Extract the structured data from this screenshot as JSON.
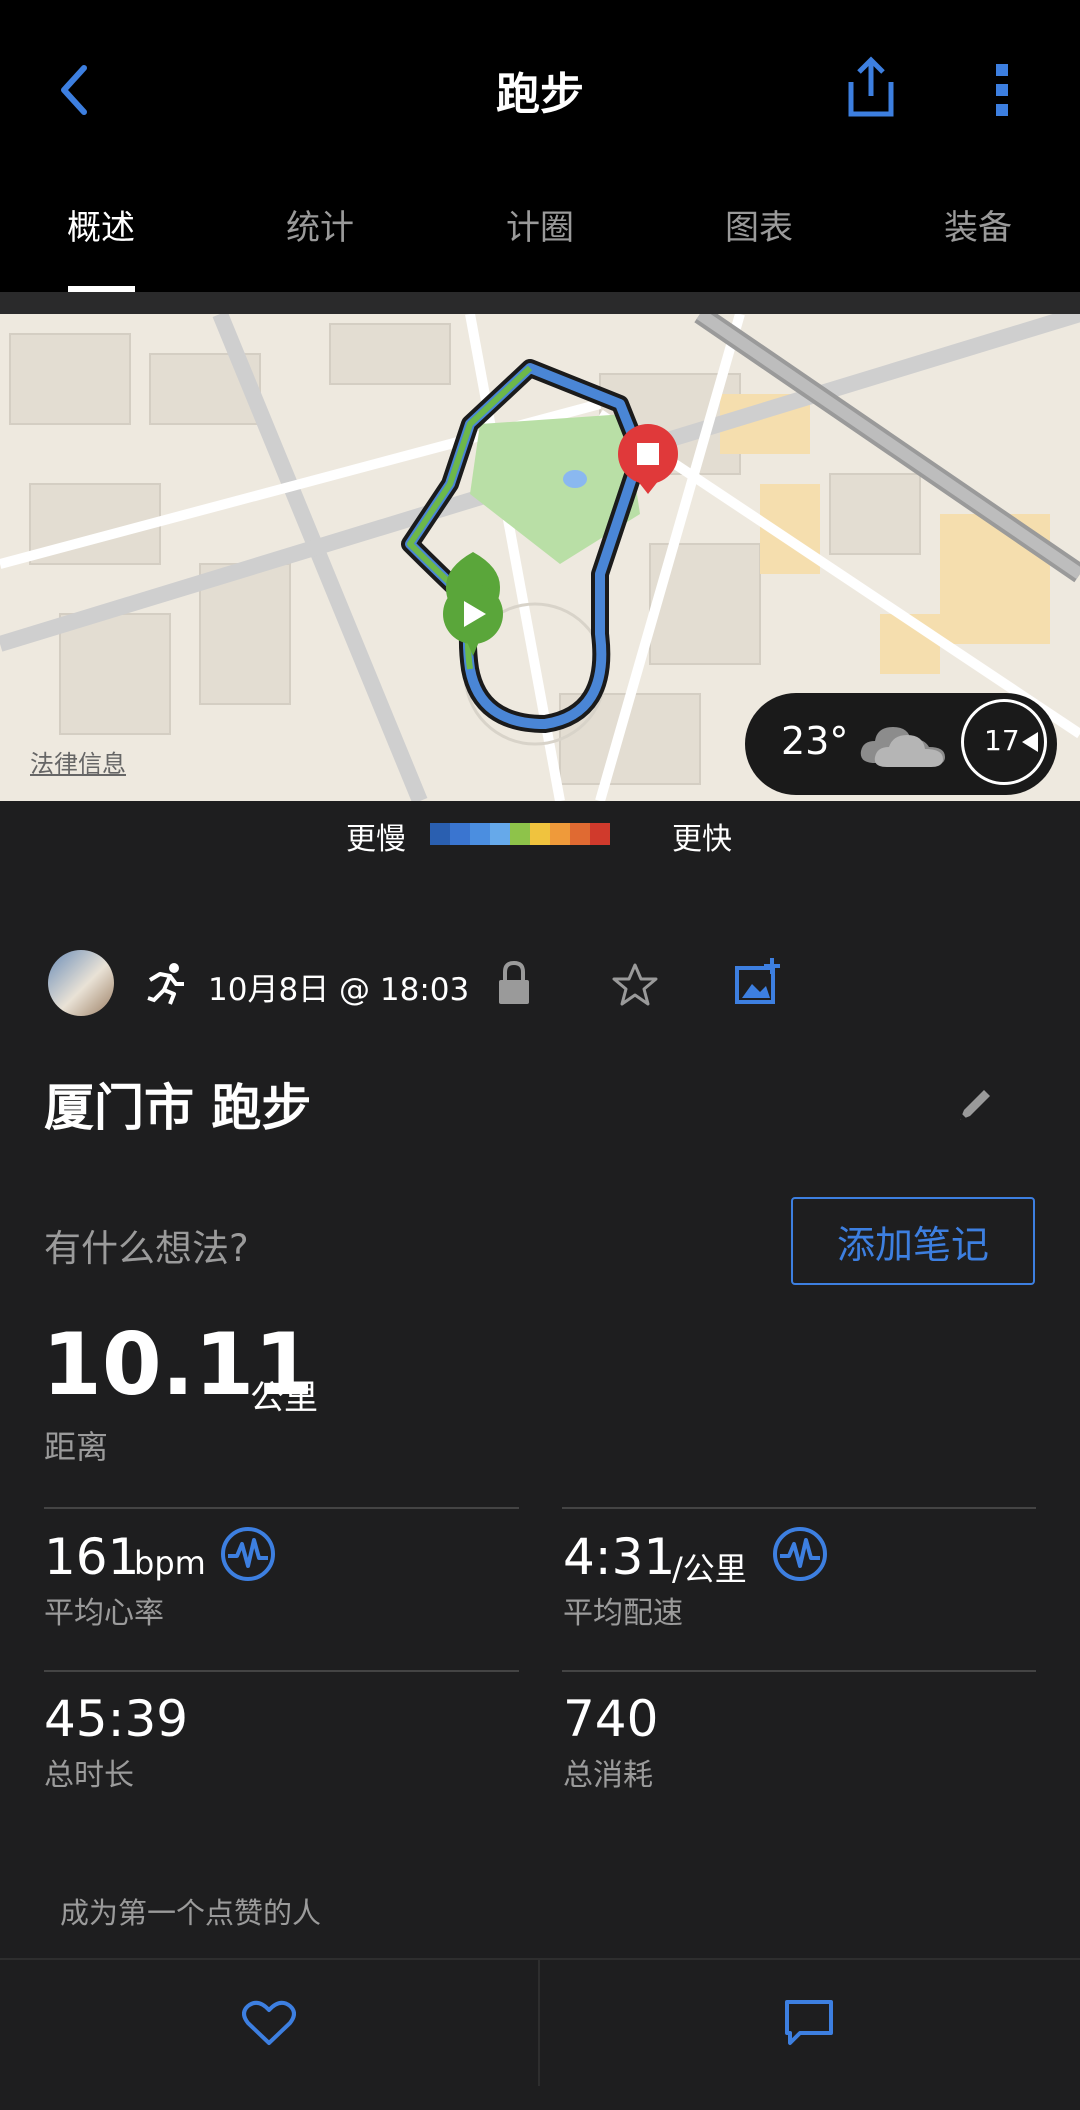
{
  "header": {
    "title": "跑步",
    "back_icon": "chevron-left-icon",
    "share_icon": "share-icon",
    "more_icon": "more-vertical-icon"
  },
  "tabs": [
    {
      "label": "概述",
      "active": true
    },
    {
      "label": "统计",
      "active": false
    },
    {
      "label": "计圈",
      "active": false
    },
    {
      "label": "图表",
      "active": false
    },
    {
      "label": "装备",
      "active": false
    }
  ],
  "map": {
    "legal_link": "法律信息",
    "weather": {
      "temperature": "23°",
      "wind": "17",
      "condition_icon": "cloud-icon"
    }
  },
  "pace_legend": {
    "slower": "更慢",
    "faster": "更快",
    "colors": [
      "#2a5fb0",
      "#3a75d0",
      "#4b8ee0",
      "#66a9ea",
      "#8ec34a",
      "#f0c33e",
      "#ef9a3a",
      "#e06a32",
      "#d03a2c"
    ]
  },
  "activity": {
    "date_time": "10月8日 @ 18:03",
    "title": "厦门市 跑步",
    "note_prompt": "有什么想法?",
    "add_note_label": "添加笔记"
  },
  "stats": {
    "distance": {
      "value": "10.11",
      "unit": "公里",
      "label": "距离"
    },
    "heart_rate": {
      "value": "161",
      "unit": "bpm",
      "label": "平均心率"
    },
    "pace": {
      "value": "4:31",
      "unit": "/公里",
      "label": "平均配速"
    },
    "duration": {
      "value": "45:39",
      "label": "总时长"
    },
    "calories": {
      "value": "740",
      "label": "总消耗"
    }
  },
  "likes_text": "成为第一个点赞的人",
  "accent_color": "#3d7fe0"
}
